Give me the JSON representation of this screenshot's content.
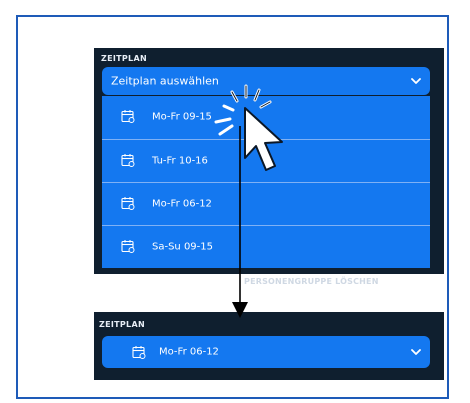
{
  "top_panel": {
    "section_label": "ZEITPLAN",
    "select_placeholder": "Zeitplan auswählen",
    "options": [
      "Mo-Fr 09-15",
      "Tu-Fr 10-16",
      "Mo-Fr 06-12",
      "Sa-Su 09-15"
    ],
    "behind_text": "PERSONENGRUPPE LÖSCHEN"
  },
  "bottom_panel": {
    "section_label": "ZEITPLAN",
    "selected_value": "Mo-Fr 06-12"
  },
  "colors": {
    "panel_bg": "#0f1f2f",
    "select_blue": "#1478f0",
    "frame_border": "#1e5bb8"
  },
  "icons": [
    "calendar-icon",
    "chevron-down-icon",
    "cursor-icon",
    "down-arrow-icon"
  ]
}
